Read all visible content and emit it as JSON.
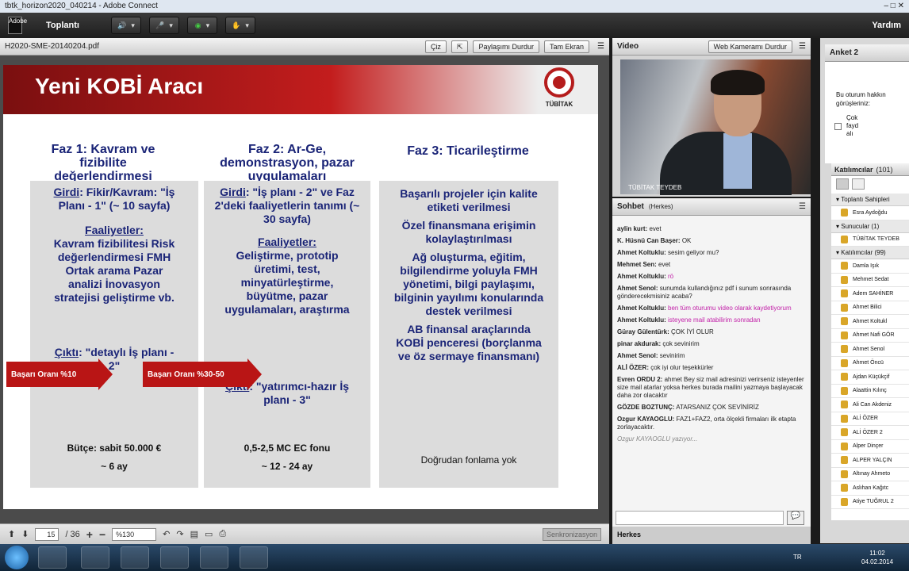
{
  "window": {
    "title": "tbtk_horizon2020_040214 - Adobe Connect"
  },
  "menubar": {
    "logo": "Adobe",
    "meeting": "Toplantı",
    "help": "Yardım"
  },
  "share": {
    "filename": "H2020-SME-20140204.pdf",
    "draw": "Çiz",
    "stop": "Paylaşımı Durdur",
    "full": "Tam Ekran",
    "page": "15",
    "total": "/ 36",
    "zoom": "%130",
    "sync": "Senkronizasyon"
  },
  "slide": {
    "title": "Yeni KOBİ Aracı",
    "logo_text": "TÜBİTAK",
    "faz1_title": "Faz 1: Kavram ve fizibilite değerlendirmesi",
    "faz2_title": "Faz 2: Ar-Ge, demonstrasyon, pazar uygulamaları",
    "faz3_title": "Faz 3: Ticarileştirme",
    "c1_girdi_label": "Girdi",
    "c1_girdi": ": Fikir/Kavram: \"İş Planı - 1\" (~ 10 sayfa)",
    "c1_faal_label": "Faaliyetler:",
    "c1_faal": "Kavram fizibilitesi Risk değerlendirmesi FMH Ortak arama Pazar analizi İnovasyon stratejisi geliştirme vb.",
    "c1_cikti_label": "Çıktı",
    "c1_cikti": ": \"detaylı İş planı - 2\"",
    "c1_butce": "Bütçe: sabit 50.000 €",
    "c1_sure": "~ 6 ay",
    "c2_girdi_label": "Girdi",
    "c2_girdi": ": \"İş planı - 2\" ve Faz 2'deki faaliyetlerin tanımı (~ 30 sayfa)",
    "c2_faal_label": "Faaliyetler:",
    "c2_faal": "Geliştirme, prototip üretimi, test, minyatürleştirme, büyütme, pazar uygulamaları, araştırma",
    "c2_cikti_label": "Çıktı",
    "c2_cikti": ": \"yatırımcı-hazır İş planı - 3\"",
    "c2_fon": "0,5-2,5 MC EC fonu",
    "c2_sure": "~ 12 - 24 ay",
    "c3_p1": "Başarılı projeler için kalite etiketi verilmesi",
    "c3_p2": "Özel finansmana erişimin kolaylaştırılması",
    "c3_p3": "Ağ oluşturma, eğitim, bilgilendirme yoluyla FMH yönetimi, bilgi paylaşımı, bilginin yayılımı konularında destek verilmesi",
    "c3_p4": "AB finansal araçlarında KOBİ penceresi (borçlanma ve öz sermaye finansmanı)",
    "c3_fon": "Doğrudan fonlama yok",
    "arrow1": "Başarı Oranı %10",
    "arrow2": "Başarı Oranı %30-50"
  },
  "video": {
    "title": "Video",
    "stop_cam": "Web Kameramı Durdur",
    "label": "TÜBİTAK TEYDEB"
  },
  "chat": {
    "title": "Sohbet",
    "scope": "(Herkes)",
    "typing": "Ozgur KAYAOGLU yazıyor...",
    "tab": "Herkes",
    "messages": [
      {
        "name": "aylin kurt:",
        "text": "evet",
        "pink": false
      },
      {
        "name": "K. Hüsnü Can Başer:",
        "text": "OK",
        "pink": false
      },
      {
        "name": "Ahmet Koltuklu:",
        "text": "sesim geliyor mu?",
        "pink": false
      },
      {
        "name": "Mehmet Sen:",
        "text": "evet",
        "pink": false
      },
      {
        "name": "Ahmet Koltuklu:",
        "text": "rö",
        "pink": true
      },
      {
        "name": "Ahmet Senol:",
        "text": "sunumda kullandığınız pdf i sunum sonrasında gönderecekmisiniz acaba?",
        "pink": false
      },
      {
        "name": "Ahmet Koltuklu:",
        "text": "ben tüm oturumu video olarak kaydetiyorum",
        "pink": true
      },
      {
        "name": "Ahmet Koltuklu:",
        "text": "isteyene mail atabilirim sonradan",
        "pink": true
      },
      {
        "name": "Güray Gülentürk:",
        "text": "ÇOK İYİ OLUR",
        "pink": false
      },
      {
        "name": "pinar akdurak:",
        "text": "çok sevinirim",
        "pink": false
      },
      {
        "name": "Ahmet Senol:",
        "text": "sevinirim",
        "pink": false
      },
      {
        "name": "ALİ ÖZER:",
        "text": "çok iyi olur teşekkürler",
        "pink": false
      },
      {
        "name": "Evren ORDU 2:",
        "text": "ahmet Bey siz mail adresinizi verirseniz isteyenler size mail atarlar yoksa herkes burada mailini yazmaya başlayacak daha zor olacaktır",
        "pink": false
      },
      {
        "name": "GÖZDE BOZTUNÇ:",
        "text": "ATARSANIZ ÇOK SEVİNİRİZ",
        "pink": false
      },
      {
        "name": "Ozgur KAYAOGLU:",
        "text": "FAZ1+FAZ2, orta ölçekli firmaları ilk etapta zorlayacaktır.",
        "pink": false
      }
    ]
  },
  "poll": {
    "title": "Anket 2",
    "question": "Bu oturum hakkın görüşleriniz:",
    "option": "Çok fayd alı"
  },
  "attendees": {
    "title": "Katılımcılar",
    "count": "(101)",
    "hosts_label": "Toplantı Sahipleri",
    "hosts": [
      "Esra Aydoğdu"
    ],
    "presenters_label": "Sunucular (1)",
    "presenters": [
      "TÜBİTAK TEYDEB"
    ],
    "participants_label": "Katılımcılar (99)",
    "participants": [
      "Damla Işık",
      "Mehmet Sedat",
      "Adem SAHİNER",
      "Ahmet Bilici",
      "Ahmet Koltukl",
      "Ahmet Nafi GÖR",
      "Ahmet Senol",
      "Ahmet Öncü",
      "Ajdan Küçükçif",
      "Alaattin Kılınç",
      "Ali Can Akdeniz",
      "ALİ ÖZER",
      "ALİ ÖZER 2",
      "Alper Dinçer",
      "ALPER YALÇIN",
      "Altınay Ahmeto",
      "Aslıhan Kağıtc",
      "Atiye TUĞRUL 2"
    ]
  },
  "taskbar": {
    "lang": "TR",
    "time": "11:02",
    "date": "04.02.2014"
  }
}
